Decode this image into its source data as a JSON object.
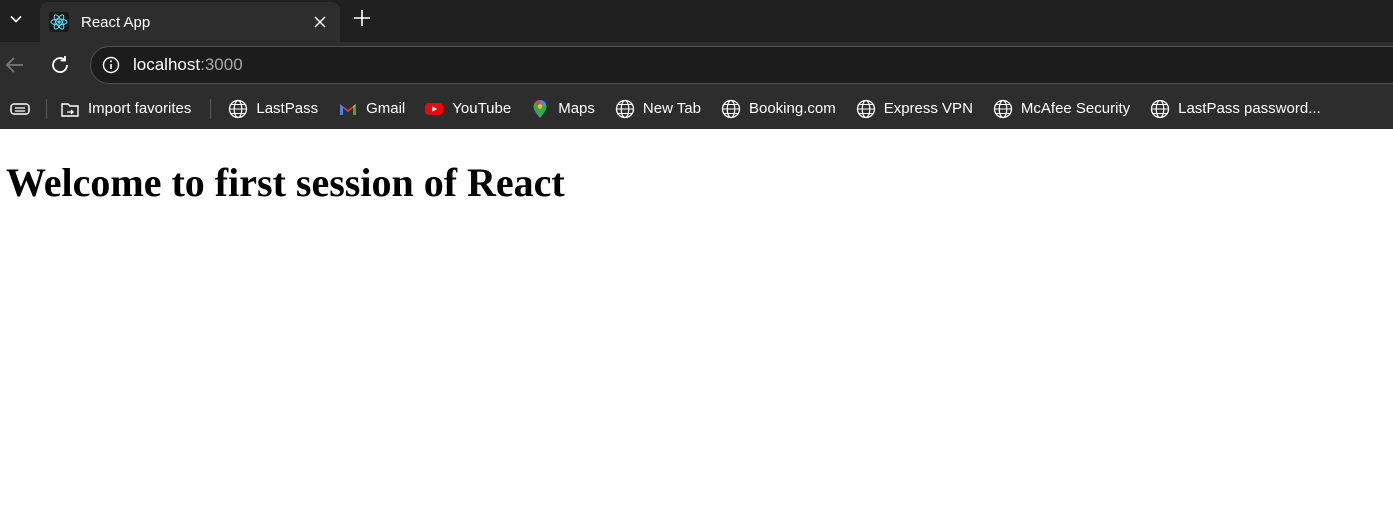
{
  "browser": {
    "tab": {
      "title": "React App",
      "favicon": "react-logo-icon"
    },
    "address": {
      "host": "localhost",
      "port": ":3000"
    },
    "favorites": [
      {
        "label": "Import favorites",
        "icon": "import-favorites-icon"
      },
      {
        "label": "LastPass",
        "icon": "globe-icon"
      },
      {
        "label": "Gmail",
        "icon": "gmail-icon"
      },
      {
        "label": "YouTube",
        "icon": "youtube-icon"
      },
      {
        "label": "Maps",
        "icon": "maps-icon"
      },
      {
        "label": "New Tab",
        "icon": "globe-icon"
      },
      {
        "label": "Booking.com",
        "icon": "globe-icon"
      },
      {
        "label": "Express VPN",
        "icon": "globe-icon"
      },
      {
        "label": "McAfee Security",
        "icon": "globe-icon"
      },
      {
        "label": "LastPass password...",
        "icon": "globe-icon"
      }
    ]
  },
  "page": {
    "heading": "Welcome to first session of React"
  },
  "colors": {
    "chrome": "#202020",
    "toolbar": "#2d2d2d",
    "omnibox": "#1c1c1c",
    "youtube": "#ff0000"
  }
}
